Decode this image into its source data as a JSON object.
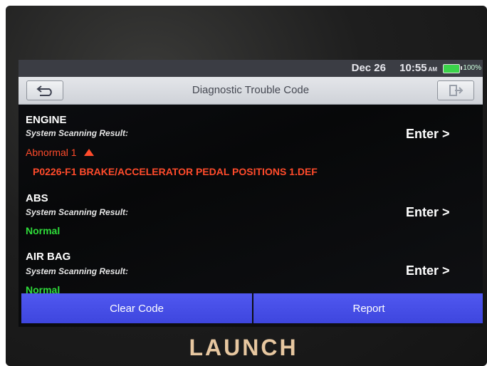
{
  "status": {
    "date": "Dec 26",
    "time": "10:55",
    "ampm": "AM",
    "battery": "100%"
  },
  "title": "Diagnostic Trouble Code",
  "systems": [
    {
      "name": "ENGINE",
      "scan_label": "System Scanning Result:",
      "result": "Abnormal 1",
      "enter": "Enter >",
      "dtc": "P0226-F1 BRAKE/ACCELERATOR PEDAL POSITIONS 1.DEF"
    },
    {
      "name": "ABS",
      "scan_label": "System Scanning Result:",
      "result": "Normal",
      "enter": "Enter >"
    },
    {
      "name": "AIR BAG",
      "scan_label": "System Scanning Result:",
      "result": "Normal",
      "enter": "Enter >"
    }
  ],
  "buttons": {
    "clear": "Clear Code",
    "report": "Report"
  },
  "brand": "LAUNCH",
  "colors": {
    "abnormal": "#ff4b2b",
    "normal": "#2fdc3a",
    "button": "#4850ea"
  }
}
